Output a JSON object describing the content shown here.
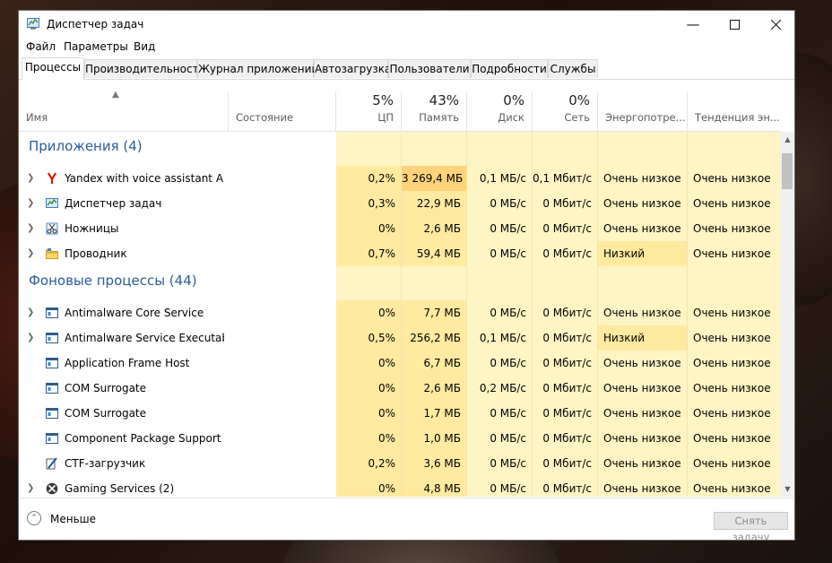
{
  "window": {
    "title": "Диспетчер задач"
  },
  "menu": [
    "Файл",
    "Параметры",
    "Вид"
  ],
  "tabs": [
    "Процессы",
    "Производительность",
    "Журнал приложений",
    "Автозагрузка",
    "Пользователи",
    "Подробности",
    "Службы"
  ],
  "columns": {
    "name": {
      "label": "Имя"
    },
    "status": {
      "label": "Состояние"
    },
    "cpu": {
      "pct": "5%",
      "label": "ЦП"
    },
    "memory": {
      "pct": "43%",
      "label": "Память"
    },
    "disk": {
      "pct": "0%",
      "label": "Диск"
    },
    "network": {
      "pct": "0%",
      "label": "Сеть"
    },
    "power": {
      "label": "Энергопотре..."
    },
    "power_trend": {
      "label": "Тенденция эн..."
    }
  },
  "groups": {
    "apps": "Приложения (4)",
    "background": "Фоновые процессы (44)"
  },
  "apps": [
    {
      "name": "Yandex with voice assistant Alic...",
      "icon": "yandex-icon",
      "cpu": "0,2%",
      "mem": "3 269,4 МБ",
      "disk": "0,1 МБ/с",
      "net": "0,1 Мбит/с",
      "power": "Очень низкое",
      "trend": "Очень низкое"
    },
    {
      "name": "Диспетчер задач",
      "icon": "task-manager-icon",
      "cpu": "0,3%",
      "mem": "22,9 МБ",
      "disk": "0 МБ/с",
      "net": "0 Мбит/с",
      "power": "Очень низкое",
      "trend": "Очень низкое"
    },
    {
      "name": "Ножницы",
      "icon": "snipping-tool-icon",
      "cpu": "0%",
      "mem": "2,6 МБ",
      "disk": "0 МБ/с",
      "net": "0 Мбит/с",
      "power": "Очень низкое",
      "trend": "Очень низкое"
    },
    {
      "name": "Проводник",
      "icon": "folder-icon",
      "cpu": "0,7%",
      "mem": "59,4 МБ",
      "disk": "0 МБ/с",
      "net": "0 Мбит/с",
      "power": "Низкий",
      "trend": "Очень низкое"
    }
  ],
  "background": [
    {
      "name": "Antimalware Core Service",
      "icon": "service-icon",
      "cpu": "0%",
      "mem": "7,7 МБ",
      "disk": "0 МБ/с",
      "net": "0 Мбит/с",
      "power": "Очень низкое",
      "trend": "Очень низкое"
    },
    {
      "name": "Antimalware Service Executable",
      "icon": "service-icon",
      "cpu": "0,5%",
      "mem": "256,2 МБ",
      "disk": "0,1 МБ/с",
      "net": "0 Мбит/с",
      "power": "Низкий",
      "trend": "Очень низкое"
    },
    {
      "name": "Application Frame Host",
      "icon": "service-icon",
      "cpu": "0%",
      "mem": "6,7 МБ",
      "disk": "0 МБ/с",
      "net": "0 Мбит/с",
      "power": "Очень низкое",
      "trend": "Очень низкое"
    },
    {
      "name": "COM Surrogate",
      "icon": "service-icon",
      "cpu": "0%",
      "mem": "2,6 МБ",
      "disk": "0,2 МБ/с",
      "net": "0 Мбит/с",
      "power": "Очень низкое",
      "trend": "Очень низкое"
    },
    {
      "name": "COM Surrogate",
      "icon": "service-icon",
      "cpu": "0%",
      "mem": "1,7 МБ",
      "disk": "0 МБ/с",
      "net": "0 Мбит/с",
      "power": "Очень низкое",
      "trend": "Очень низкое"
    },
    {
      "name": "Component Package Support S...",
      "icon": "service-icon",
      "cpu": "0%",
      "mem": "1,0 МБ",
      "disk": "0 МБ/с",
      "net": "0 Мбит/с",
      "power": "Очень низкое",
      "trend": "Очень низкое"
    },
    {
      "name": "CTF-загрузчик",
      "icon": "ctf-loader-icon",
      "cpu": "0,2%",
      "mem": "3,6 МБ",
      "disk": "0 МБ/с",
      "net": "0 Мбит/с",
      "power": "Очень низкое",
      "trend": "Очень низкое"
    },
    {
      "name": "Gaming Services (2)",
      "icon": "xbox-icon",
      "cpu": "0%",
      "mem": "4,8 МБ",
      "disk": "0 МБ/с",
      "net": "0 Мбит/с",
      "power": "Очень низкое",
      "trend": "Очень низкое"
    }
  ],
  "footer": {
    "less": "Меньше",
    "end_task": "Снять задачу"
  },
  "colors": {
    "group_title": "#2d5c9b",
    "cell_light": "#fff4c4",
    "cell_mid": "#ffeaa0",
    "cell_high": "#ffd37a"
  }
}
